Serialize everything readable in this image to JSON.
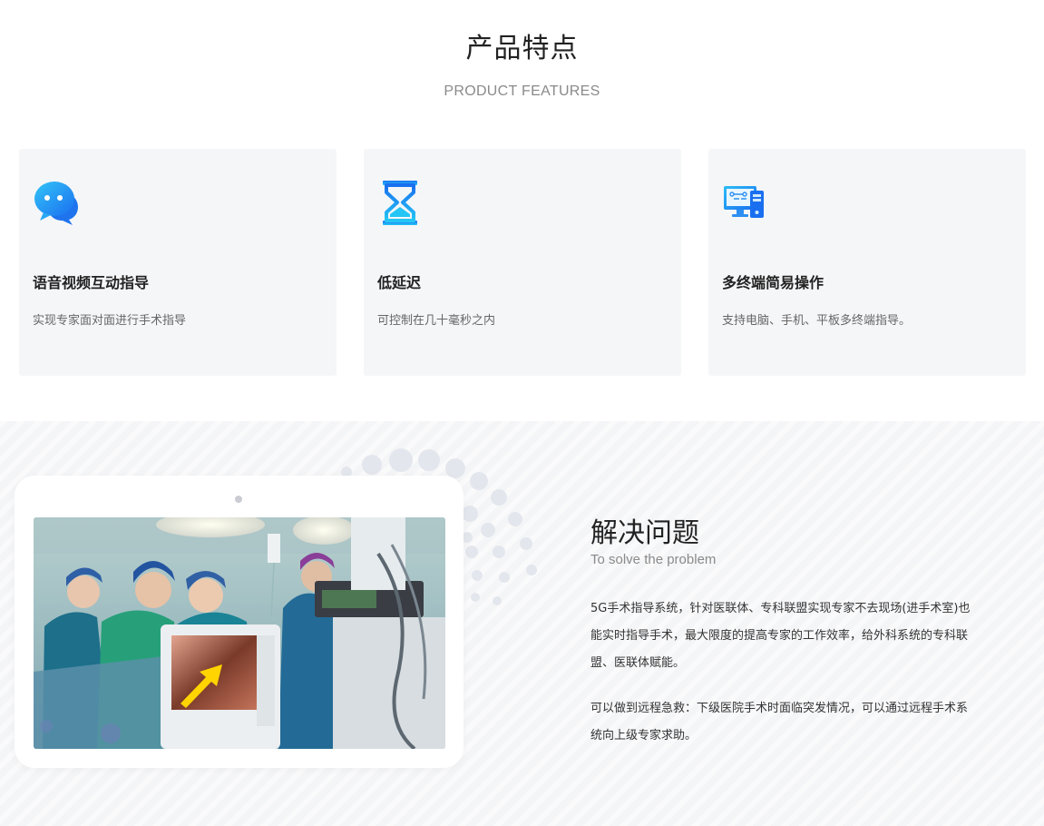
{
  "header": {
    "title": "产品特点",
    "subtitle": "PRODUCT FEATURES"
  },
  "features": [
    {
      "icon": "chat-bubble-icon",
      "title": "语音视频互动指导",
      "desc": "实现专家面对面进行手术指导"
    },
    {
      "icon": "hourglass-icon",
      "title": "低延迟",
      "desc": "可控制在几十毫秒之内"
    },
    {
      "icon": "multi-device-icon",
      "title": "多终端简易操作",
      "desc": "支持电脑、手机、平板多终端指导。"
    }
  ],
  "solution": {
    "title": "解决问题",
    "subtitle": "To solve the problem",
    "paragraphs": [
      "5G手术指导系统，针对医联体、专科联盟实现专家不去现场(进手术室)也能实时指导手术，最大限度的提高专家的工作效率，给外科系统的专科联盟、医联体赋能。",
      "可以做到远程急救：下级医院手术时面临突发情况，可以通过远程手术系统向上级专家求助。"
    ]
  },
  "colors": {
    "accent_blue": "#1f7ff0",
    "accent_cyan": "#25c6f5",
    "card_bg": "#f5f6f8",
    "band_bg": "#f4f5f7"
  }
}
